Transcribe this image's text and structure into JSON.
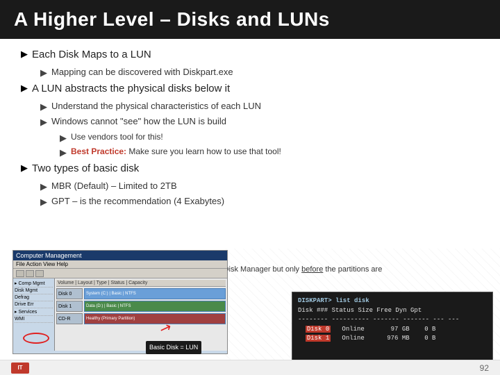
{
  "slide": {
    "title": "A Higher Level – Disks and LUNs",
    "bullets": {
      "b1": {
        "text": "Each Disk Maps to a LUN",
        "sub1": "Mapping can be discovered with Diskpart.exe"
      },
      "b2": {
        "text": "A LUN abstracts the physical disks below it",
        "sub1": "Understand the physical characteristics of each LUN",
        "sub2": "Windows cannot \"see\" how the LUN is build",
        "sub2a": "Use vendors tool for this!",
        "sub2b_prefix": "Best Practice:",
        "sub2b_suffix": " Make sure you learn how to use that tool!"
      },
      "b3": {
        "text": "Two types of basic disk",
        "sub1": "MBR (Default) – Limited to 2TB",
        "sub2_prefix": "GPT – is the re",
        "sub2_suffix": "commendation (4 Exabytes)"
      }
    },
    "caption": {
      "text": " Disk Manager but only before the partitions are"
    },
    "diskpart": {
      "cmd": "DISKPART> list disk",
      "header": "  Disk ###  Status      Size     Free  Dyn  Gpt",
      "separator": "  --------  ----------  -------  -------  ---  ---",
      "row1": "  Disk 0    Online       97 GB    0 B",
      "row2": "  Disk 1    Online      976 MB    0 B"
    },
    "footer": {
      "page": "92"
    },
    "basic_disk_label": "Basic\nDisk\n=\nLUN"
  }
}
